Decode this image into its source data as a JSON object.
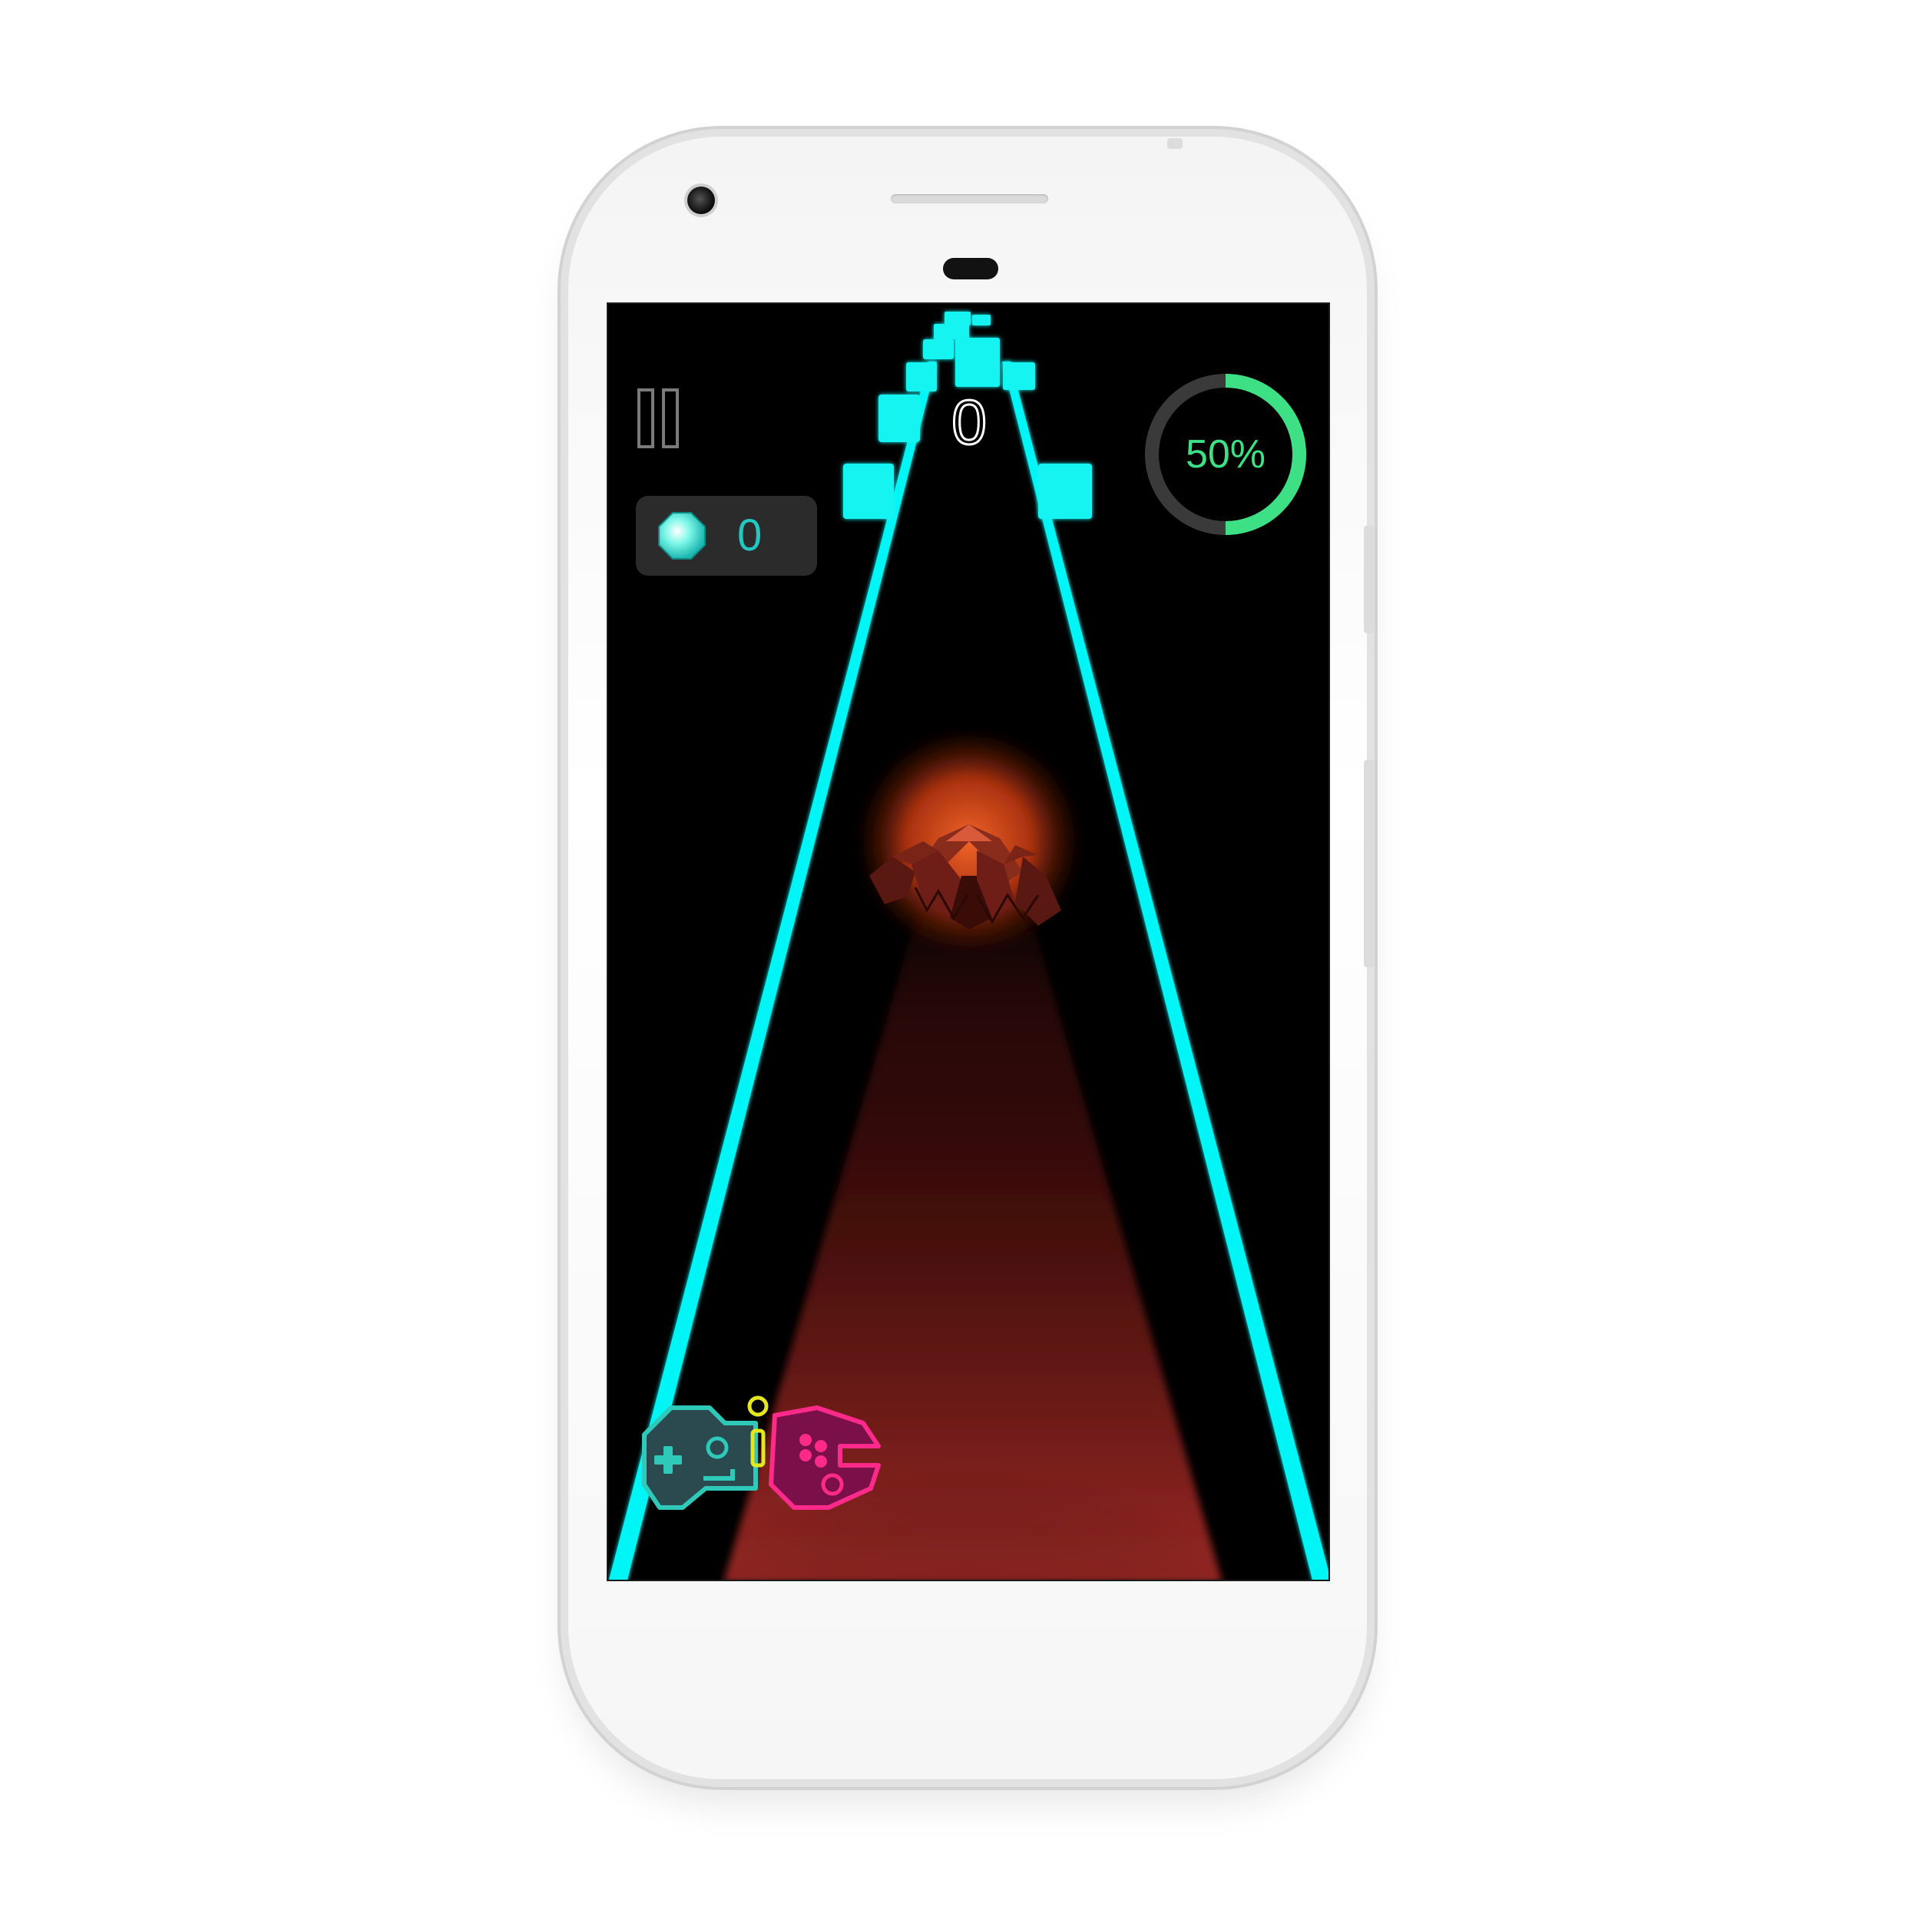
{
  "hud": {
    "score": "0",
    "gems": "0",
    "progress_label": "50%",
    "progress_value": 0.5
  },
  "icons": {
    "pause": "pause-icon",
    "gem": "gem-icon",
    "controller": "gamepad-icon",
    "enemy": "spiked-creature"
  },
  "colors": {
    "track": "#00f6f6",
    "block": "#12f4f2",
    "progress": "#3ee085",
    "progress_track": "#3a3a3a",
    "glow": "#b5302b",
    "controller_left": "#2ec9b9",
    "controller_right": "#ff2a8a",
    "controller_mid": "#e6e61e"
  }
}
